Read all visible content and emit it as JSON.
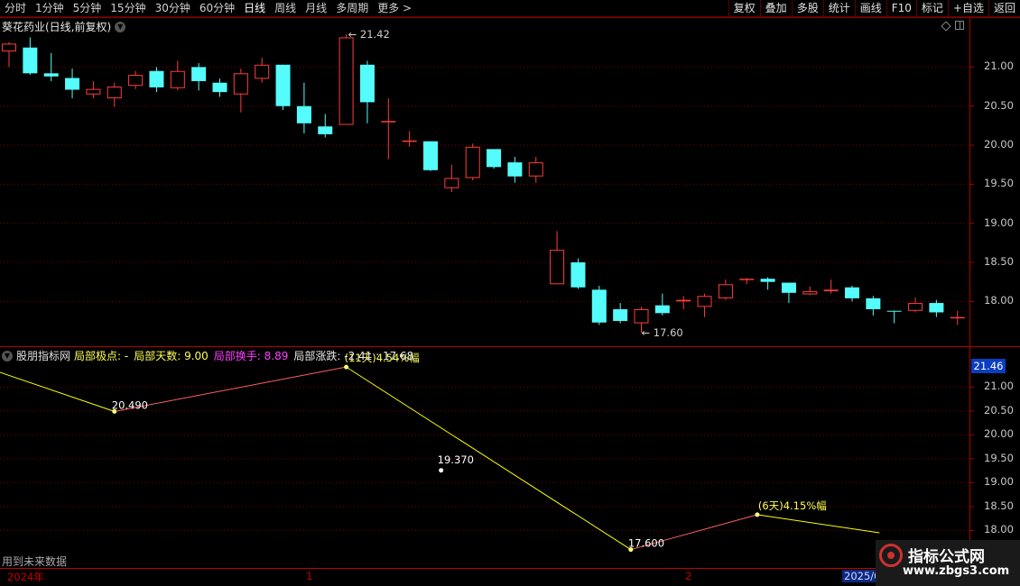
{
  "toolbar": {
    "periods": [
      "分时",
      "1分钟",
      "5分钟",
      "15分钟",
      "30分钟",
      "60分钟",
      "日线",
      "周线",
      "月线",
      "多周期",
      "更多 >"
    ],
    "active_period": "日线",
    "buttons": [
      "复权",
      "叠加",
      "多股",
      "统计",
      "画线",
      "F10",
      "标记",
      "+自选",
      "返回"
    ]
  },
  "main_chart": {
    "title": "葵花药业(日线,前复权)",
    "max_label": "21.42",
    "min_label": "17.60",
    "y_ticks": [
      "21.00",
      "20.50",
      "20.00",
      "19.50",
      "19.00",
      "18.50",
      "18.00"
    ]
  },
  "indicator": {
    "name": "股朋指标网",
    "fields": [
      {
        "label": "局部极点: -",
        "color": "#ffff54"
      },
      {
        "label": "局部天数: 9.00",
        "color": "#ffff54"
      },
      {
        "label": "局部换手: 8.89",
        "color": "#ff40ff"
      },
      {
        "label": "局部涨跌: -2.41 : 17.68",
        "color": "#e8e8e8"
      }
    ],
    "y_ticks": [
      "21.00",
      "20.50",
      "20.00",
      "19.50",
      "19.00",
      "18.50",
      "18.00"
    ],
    "current_value": "21.46",
    "annotations": [
      "20.490",
      "(11天)4.54%幅",
      "19.370",
      "17.600",
      "(6天)4.15%幅"
    ],
    "future_note": "用到未来数据"
  },
  "date_bar": {
    "labels": [
      "2024年",
      "1",
      "2"
    ],
    "selected": "2025/0"
  },
  "watermark": {
    "title": "指标公式网",
    "url": "www.zbgs3.com"
  },
  "colors": {
    "up": "#ff3c3c",
    "down": "#54fcfc",
    "grid": "#7a0000",
    "zigzag_down": "#ffff00",
    "zigzag_up": "#ff6060"
  },
  "chart_data": {
    "type": "candlestick",
    "price_range": [
      17.5,
      21.6
    ],
    "candles": [
      {
        "o": 21.2,
        "c": 21.3,
        "h": 21.32,
        "l": 21.0
      },
      {
        "o": 21.25,
        "c": 20.92,
        "h": 21.38,
        "l": 20.9
      },
      {
        "o": 20.92,
        "c": 20.88,
        "h": 21.18,
        "l": 20.82
      },
      {
        "o": 20.86,
        "c": 20.71,
        "h": 20.98,
        "l": 20.6
      },
      {
        "o": 20.65,
        "c": 20.72,
        "h": 20.82,
        "l": 20.6
      },
      {
        "o": 20.6,
        "c": 20.75,
        "h": 20.8,
        "l": 20.49
      },
      {
        "o": 20.76,
        "c": 20.9,
        "h": 20.95,
        "l": 20.72
      },
      {
        "o": 20.95,
        "c": 20.74,
        "h": 21.0,
        "l": 20.68
      },
      {
        "o": 20.73,
        "c": 20.95,
        "h": 21.08,
        "l": 20.7
      },
      {
        "o": 21.0,
        "c": 20.82,
        "h": 21.05,
        "l": 20.7
      },
      {
        "o": 20.8,
        "c": 20.68,
        "h": 20.85,
        "l": 20.62
      },
      {
        "o": 20.65,
        "c": 20.92,
        "h": 20.98,
        "l": 20.42
      },
      {
        "o": 20.85,
        "c": 21.03,
        "h": 21.12,
        "l": 20.8
      },
      {
        "o": 21.03,
        "c": 20.5,
        "h": 21.03,
        "l": 20.45
      },
      {
        "o": 20.5,
        "c": 20.28,
        "h": 20.8,
        "l": 20.15
      },
      {
        "o": 20.24,
        "c": 20.14,
        "h": 20.4,
        "l": 20.1
      },
      {
        "o": 20.26,
        "c": 21.38,
        "h": 21.42,
        "l": 20.26
      },
      {
        "o": 21.03,
        "c": 20.55,
        "h": 21.08,
        "l": 20.28
      },
      {
        "o": 20.31,
        "c": 20.31,
        "h": 20.6,
        "l": 19.82
      },
      {
        "o": 20.06,
        "c": 20.06,
        "h": 20.18,
        "l": 19.98
      },
      {
        "o": 20.05,
        "c": 19.68,
        "h": 20.05,
        "l": 19.67
      },
      {
        "o": 19.45,
        "c": 19.58,
        "h": 19.75,
        "l": 19.4
      },
      {
        "o": 19.58,
        "c": 19.98,
        "h": 20.02,
        "l": 19.55
      },
      {
        "o": 19.95,
        "c": 19.72,
        "h": 19.95,
        "l": 19.7
      },
      {
        "o": 19.78,
        "c": 19.6,
        "h": 19.85,
        "l": 19.52
      },
      {
        "o": 19.6,
        "c": 19.78,
        "h": 19.85,
        "l": 19.52
      },
      {
        "o": 18.22,
        "c": 18.66,
        "h": 18.9,
        "l": 18.22
      },
      {
        "o": 18.5,
        "c": 18.18,
        "h": 18.55,
        "l": 18.16
      },
      {
        "o": 18.15,
        "c": 17.73,
        "h": 18.2,
        "l": 17.7
      },
      {
        "o": 17.9,
        "c": 17.75,
        "h": 17.98,
        "l": 17.72
      },
      {
        "o": 17.72,
        "c": 17.9,
        "h": 17.93,
        "l": 17.6
      },
      {
        "o": 17.95,
        "c": 17.85,
        "h": 18.1,
        "l": 17.82
      },
      {
        "o": 18.0,
        "c": 18.02,
        "h": 18.07,
        "l": 17.9
      },
      {
        "o": 17.93,
        "c": 18.07,
        "h": 18.1,
        "l": 17.8
      },
      {
        "o": 18.04,
        "c": 18.22,
        "h": 18.28,
        "l": 18.02
      },
      {
        "o": 18.28,
        "c": 18.29,
        "h": 18.3,
        "l": 18.22
      },
      {
        "o": 18.29,
        "c": 18.25,
        "h": 18.31,
        "l": 18.15
      },
      {
        "o": 18.24,
        "c": 18.11,
        "h": 18.24,
        "l": 17.98
      },
      {
        "o": 18.09,
        "c": 18.13,
        "h": 18.19,
        "l": 18.08
      },
      {
        "o": 18.13,
        "c": 18.15,
        "h": 18.28,
        "l": 18.1
      },
      {
        "o": 18.18,
        "c": 18.04,
        "h": 18.2,
        "l": 18.0
      },
      {
        "o": 18.04,
        "c": 17.9,
        "h": 18.07,
        "l": 17.82
      },
      {
        "o": 17.88,
        "c": 17.87,
        "h": 17.88,
        "l": 17.72
      },
      {
        "o": 17.88,
        "c": 17.98,
        "h": 18.05,
        "l": 17.86
      },
      {
        "o": 17.98,
        "c": 17.86,
        "h": 18.02,
        "l": 17.8
      },
      {
        "o": 17.8,
        "c": 17.8,
        "h": 17.88,
        "l": 17.7
      }
    ],
    "zigzag": {
      "range": [
        17.9,
        21.46
      ],
      "points": [
        {
          "i": -0.5,
          "v": 21.32
        },
        {
          "i": 5,
          "v": 20.49,
          "label": "20.490"
        },
        {
          "i": 16,
          "v": 21.42,
          "label": "(11天)4.54%幅"
        },
        {
          "i": 29.5,
          "v": 17.6,
          "label": "17.600"
        },
        {
          "i": 35.5,
          "v": 18.33,
          "label": "(6天)4.15%幅"
        },
        {
          "i": 41.3,
          "v": 17.95
        }
      ],
      "isolated_point": {
        "i": 20.5,
        "v": 19.37,
        "label": "19.370"
      }
    }
  }
}
